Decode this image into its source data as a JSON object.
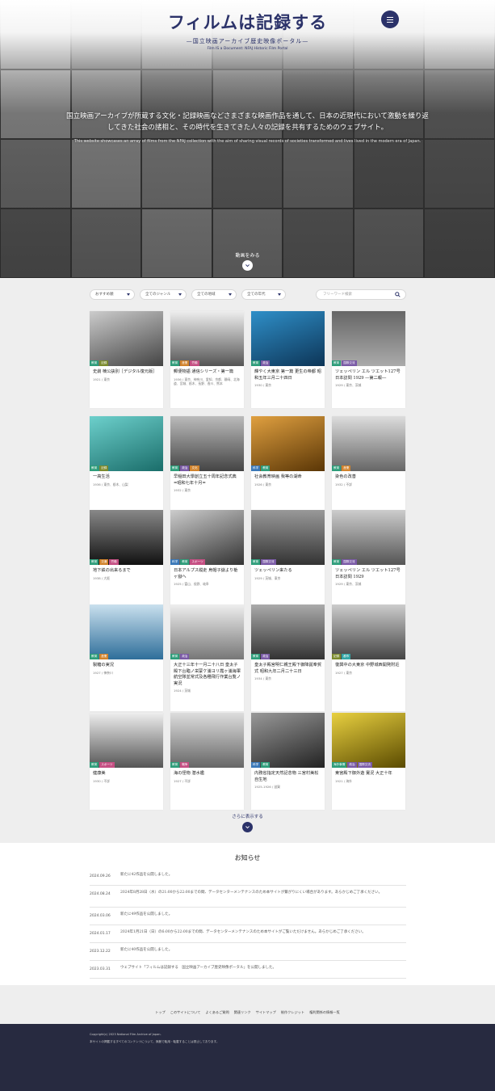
{
  "header": {
    "title": "フィルムは記録する",
    "subtitle": "—国立映画アーカイブ歴史映像ポータル—",
    "subtitle_en": "Film IS a Document: NFAJ Historic Film Portal"
  },
  "hero": {
    "description": "国立映画アーカイブが所蔵する文化・記録映画などさまざまな映画作品を通して、日本の近現代において激動を繰り返してきた社会の諸相と、その時代を生きてきた人々の記録を共有するためのウェブサイト。",
    "description_en": "This website showcases an array of films from the NFAJ collection with the aim of sharing visual records of societies transformed and lives lived in the modern era of Japan.",
    "watch_label": "動画をみる"
  },
  "filters": {
    "sort": "おすすめ順",
    "genre": "全てのジャンル",
    "region": "全ての地域",
    "era": "全ての年代",
    "search_placeholder": "フリーワード検索"
  },
  "tag_colors": {
    "green": "#2e9d7a",
    "purple": "#7a5aa6",
    "blue": "#3a78b8",
    "orange": "#d1832c",
    "teal": "#33a6a6",
    "pink": "#c54f83",
    "olive": "#7b8a2d"
  },
  "cards": [
    {
      "title": "史劇 楠公訣別［デジタル復元版］",
      "meta": "1921 / 東京",
      "tags": [
        "教育",
        "記録"
      ]
    },
    {
      "title": "郵便物語 通信シリーズ・第一篇",
      "meta": "1936 / 東京、神奈川、愛知、京都、静岡、北海道、宮城、栃木、長野、香川、熊本",
      "tags": [
        "教育",
        "産業",
        "労働"
      ]
    },
    {
      "title": "輝やく大東京 第一篇 更生の帝都 昭和五年三月二十四日",
      "meta": "1930 / 東京",
      "tags": [
        "教育",
        "政治"
      ]
    },
    {
      "title": "ツェッペリン エル ツエット127号 日本訪問 1929 ―第二報―",
      "meta": "1929 / 東京、茨城",
      "tags": [
        "教育",
        "国際交流"
      ]
    },
    {
      "title": "一高生活",
      "meta": "1936 / 東京、栃木、山梨",
      "tags": [
        "教育",
        "記録"
      ]
    },
    {
      "title": "早稲田大學創立五十周年記念式典 =昭和七年十月=",
      "meta": "1932 / 東京",
      "tags": [
        "教育",
        "政治",
        "文化"
      ]
    },
    {
      "title": "社会教育映画 我等の湖命",
      "meta": "1926 / 東京",
      "tags": [
        "科学",
        "教育"
      ]
    },
    {
      "title": "染色の改善",
      "meta": "1932 / 不詳",
      "tags": [
        "教育",
        "産業"
      ]
    },
    {
      "title": "地下鉄の出来るまで",
      "meta": "1938 / 大阪",
      "tags": [
        "教育",
        "交通",
        "労働"
      ]
    },
    {
      "title": "日本アルプス縦走 烏帽子嶽より槍ヶ嶽へ",
      "meta": "1925 / 富山、長野、岐阜",
      "tags": [
        "科学",
        "教育",
        "スポーツ"
      ]
    },
    {
      "title": "ツェッペリン来たる",
      "meta": "1929 / 茨城、東京",
      "tags": [
        "教育",
        "国際交流"
      ]
    },
    {
      "title": "ツェッペリン エル ツエット127号 日本訪問 1929",
      "meta": "1929 / 東京、茨城",
      "tags": [
        "教育",
        "国際交流"
      ]
    },
    {
      "title": "製糖の実況",
      "meta": "1927 / 神奈川",
      "tags": [
        "教育",
        "産業"
      ]
    },
    {
      "title": "大正十三年十一月二十八日 皇太子殿下台臨ノ栄蒙ケ浦ヨリ霞ヶ浦海軍航空隊並常式及各種飛行作業台覧ノ実況",
      "meta": "1924 / 茨城",
      "tags": [
        "教育",
        "政治"
      ]
    },
    {
      "title": "皇太子殿宮明仁親王殿下御降誕奉賀式 昭和九年二月二十三日",
      "meta": "1934 / 東京",
      "tags": [
        "教育",
        "政治"
      ]
    },
    {
      "title": "復興中の大東京 中野城西開発附近",
      "meta": "1927 / 東京",
      "tags": [
        "記録",
        "都市"
      ]
    },
    {
      "title": "健康美",
      "meta": "1930 / 不詳",
      "tags": [
        "教育",
        "スポーツ"
      ]
    },
    {
      "title": "海の怪物 潜水艦",
      "meta": "1927 / 不詳",
      "tags": [
        "教育",
        "戦争"
      ]
    },
    {
      "title": "内務省指定天然記念物 三宮村美松自生地",
      "meta": "1925-1926 / 滋賀",
      "tags": [
        "科学",
        "教育"
      ]
    },
    {
      "title": "東宮殿下御外遊 實況 大正十年",
      "meta": "1921 / 海外",
      "tags": [
        "海外事情",
        "政治",
        "国際交流"
      ]
    }
  ],
  "more_label": "さらに表示する",
  "news": {
    "heading": "お知らせ",
    "items": [
      {
        "date": "2024.09.26",
        "text": "新たに42作品を公開しました。"
      },
      {
        "date": "2024.08.24",
        "text": "2024年8月28日（水）の21:00から22:00までの間、データセンターメンテナンスのため本サイトが繋がりにくい場合があります。あらかじめご了承ください。"
      },
      {
        "date": "2024.03.06",
        "text": "新たに49作品を公開しました。"
      },
      {
        "date": "2024.01.17",
        "text": "2024年1月21日（日）の6:00から22:00までの間、データセンターメンテナンスのため本サイトがご覧いただけません。あらかじめご了承ください。"
      },
      {
        "date": "2023.12.22",
        "text": "新たに40作品を公開しました。"
      },
      {
        "date": "2023.03.31",
        "text": "ウェブサイト「フィルムは記録する　国立映画アーカイブ歴史映像ポータル」を公開しました。"
      }
    ]
  },
  "footer": {
    "links": [
      "トップ",
      "このサイトについて",
      "よくあるご質問",
      "関連リンク",
      "サイトマップ",
      "制作クレジット",
      "権利関係の情報一覧"
    ],
    "copyright": "Copyright(c) 2023 National Film Archive of Japan.",
    "notice": "本サイトの掲載するすべてのコンテンツについて、無断で転用・転載することは禁止しております。"
  }
}
